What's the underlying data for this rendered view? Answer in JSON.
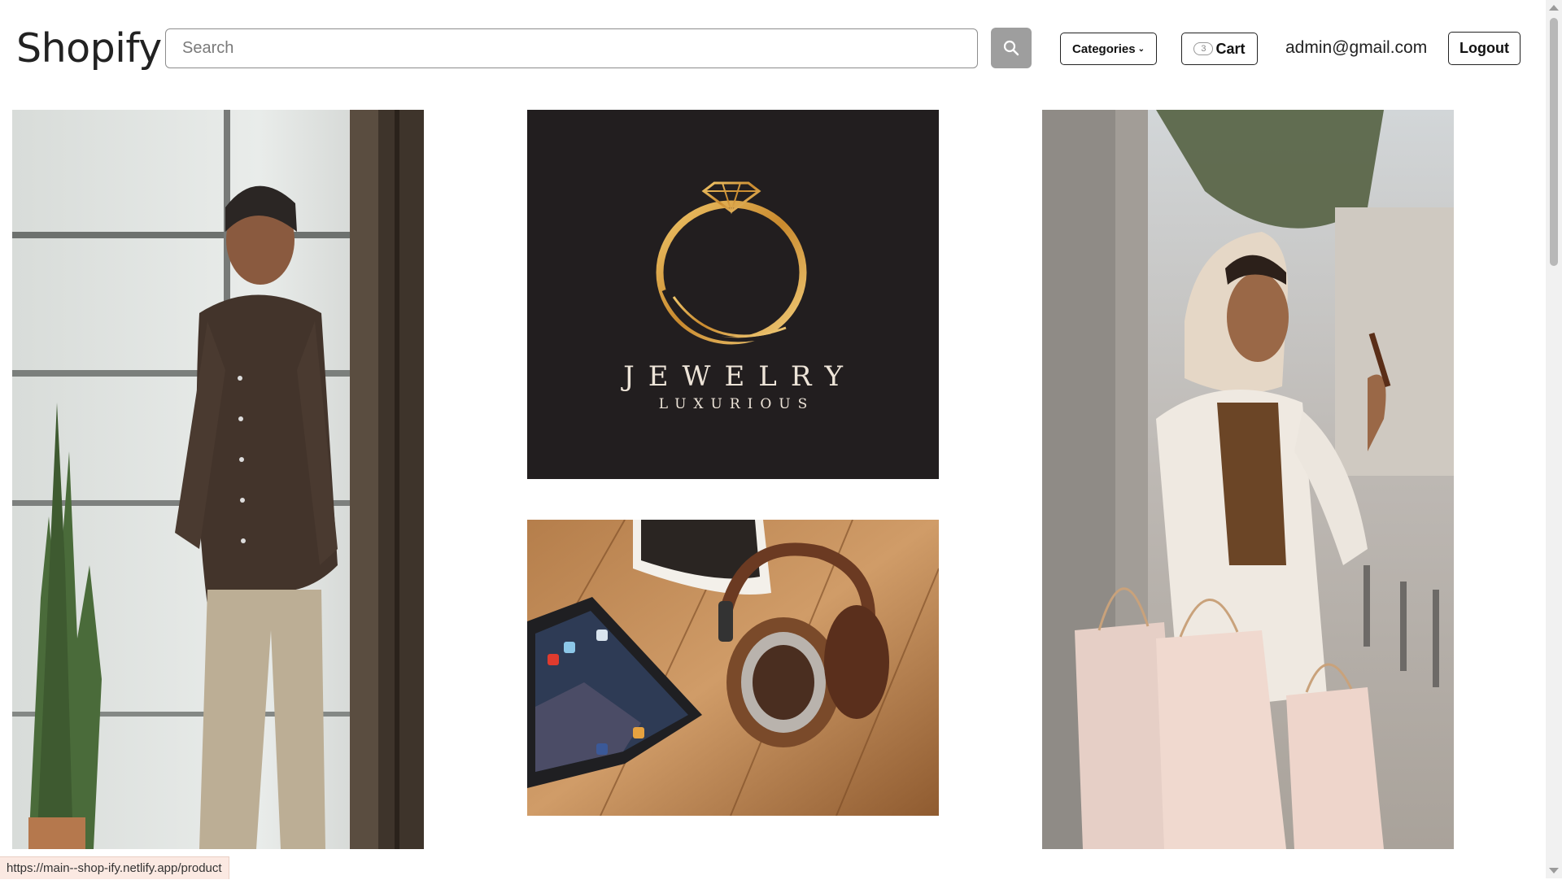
{
  "navbar": {
    "brand": "Shopify",
    "search": {
      "placeholder": "Search",
      "value": ""
    },
    "search_icon": "search-icon",
    "categories_label": "Categories",
    "cart": {
      "count": "3",
      "label": "Cart"
    },
    "user_email": "admin@gmail.com",
    "logout_label": "Logout"
  },
  "tiles": [
    {
      "name": "men-fashion",
      "description_icon": "man-in-shirt-photo"
    },
    {
      "name": "jewelry",
      "title": "JEWELRY",
      "subtitle": "LUXURIOUS"
    },
    {
      "name": "electronics",
      "description_icon": "tablet-headphones-photo"
    },
    {
      "name": "women-fashion",
      "description_icon": "woman-shopping-bags-photo"
    }
  ],
  "status_bar": {
    "url": "https://main--shop-ify.netlify.app/product"
  },
  "colors": {
    "jewelry_bg": "#221e1f",
    "gold": "#c9913a",
    "search_button": "#9e9e9e"
  }
}
